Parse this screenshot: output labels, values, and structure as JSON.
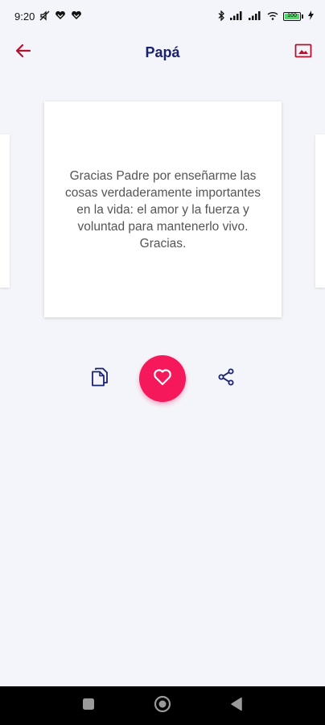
{
  "status_bar": {
    "time": "9:20",
    "left_icons": [
      "mute-icon",
      "heart-notification-icon",
      "heart-notification-icon"
    ],
    "right_icons": [
      "bluetooth-icon",
      "signal-icon",
      "signal-icon",
      "wifi-icon",
      "battery-icon",
      "charging-icon"
    ],
    "battery_level": "100"
  },
  "app_bar": {
    "title": "Papá",
    "back_icon": "arrow-left-icon",
    "action_icon": "image-icon"
  },
  "card": {
    "text": "Gracias Padre por enseñarme las cosas verdaderamente importantes en la vida: el amor y la fuerza y voluntad para mantenerlo vivo. Gracias."
  },
  "actions": {
    "copy_icon": "copy-icon",
    "favorite_icon": "heart-icon",
    "share_icon": "share-icon"
  },
  "colors": {
    "background": "#f4f5fa",
    "title": "#1a2270",
    "accent_red": "#b3122e",
    "favorite": "#f5185a",
    "icon_navy": "#1a2270",
    "card_text": "#555555"
  },
  "nav_bar": {
    "icons": [
      "square-icon",
      "circle-icon",
      "triangle-back-icon"
    ]
  }
}
